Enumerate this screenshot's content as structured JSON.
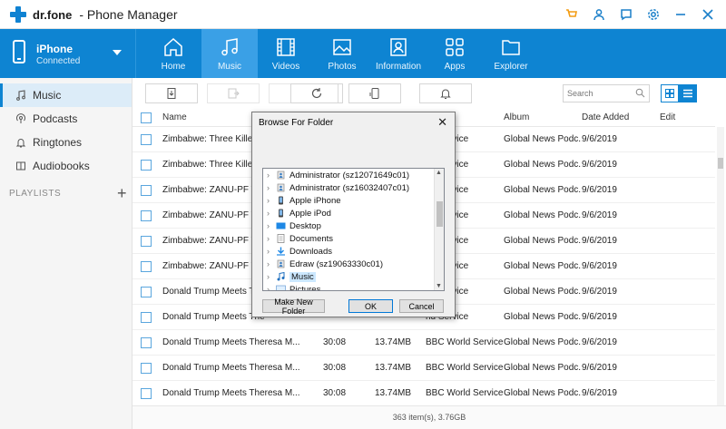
{
  "titlebar": {
    "logo_text": "dr.fone",
    "app_title": "- Phone Manager"
  },
  "device": {
    "name": "iPhone",
    "status": "Connected"
  },
  "nav": {
    "tabs": [
      {
        "label": "Home",
        "icon": "home-icon"
      },
      {
        "label": "Music",
        "icon": "music-icon"
      },
      {
        "label": "Videos",
        "icon": "film-icon"
      },
      {
        "label": "Photos",
        "icon": "photo-icon"
      },
      {
        "label": "Information",
        "icon": "contact-card-icon"
      },
      {
        "label": "Apps",
        "icon": "apps-grid-icon"
      },
      {
        "label": "Explorer",
        "icon": "folder-icon"
      }
    ],
    "active": "Music"
  },
  "sidebar": {
    "items": [
      {
        "label": "Music",
        "icon": "music-note-icon"
      },
      {
        "label": "Podcasts",
        "icon": "podcast-icon"
      },
      {
        "label": "Ringtones",
        "icon": "bell-icon"
      },
      {
        "label": "Audiobooks",
        "icon": "book-icon"
      }
    ],
    "playlists_label": "PLAYLISTS",
    "add_label": "+"
  },
  "toolbar": {
    "search_placeholder": "Search"
  },
  "table": {
    "headers": {
      "name": "Name",
      "album": "Album",
      "date_added": "Date Added",
      "edit": "Edit"
    },
    "rows": [
      {
        "name": "Zimbabwe: Three Killed a",
        "time": "",
        "size": "",
        "artist": "rld Service",
        "album": "Global News Podc...",
        "date": "9/6/2019"
      },
      {
        "name": "Zimbabwe: Three Killed a",
        "time": "",
        "size": "",
        "artist": "rld Service",
        "album": "Global News Podc...",
        "date": "9/6/2019"
      },
      {
        "name": "Zimbabwe: ZANU-PF Wins",
        "time": "",
        "size": "",
        "artist": "rld Service",
        "album": "Global News Podc...",
        "date": "9/6/2019"
      },
      {
        "name": "Zimbabwe: ZANU-PF Wins",
        "time": "",
        "size": "",
        "artist": "rld Service",
        "album": "Global News Podc...",
        "date": "9/6/2019"
      },
      {
        "name": "Zimbabwe: ZANU-PF Wins",
        "time": "",
        "size": "",
        "artist": "rld Service",
        "album": "Global News Podc...",
        "date": "9/6/2019"
      },
      {
        "name": "Zimbabwe: ZANU-PF Wins",
        "time": "",
        "size": "",
        "artist": "rld Service",
        "album": "Global News Podc...",
        "date": "9/6/2019"
      },
      {
        "name": "Donald Trump Meets The",
        "time": "",
        "size": "",
        "artist": "rld Service",
        "album": "Global News Podc...",
        "date": "9/6/2019"
      },
      {
        "name": "Donald Trump Meets The",
        "time": "",
        "size": "",
        "artist": "rld Service",
        "album": "Global News Podc...",
        "date": "9/6/2019"
      },
      {
        "name": "Donald Trump Meets Theresa M...",
        "time": "30:08",
        "size": "13.74MB",
        "artist": "BBC World Service",
        "album": "Global News Podc...",
        "date": "9/6/2019"
      },
      {
        "name": "Donald Trump Meets Theresa M...",
        "time": "30:08",
        "size": "13.74MB",
        "artist": "BBC World Service",
        "album": "Global News Podc...",
        "date": "9/6/2019"
      },
      {
        "name": "Donald Trump Meets Theresa M...",
        "time": "30:08",
        "size": "13.74MB",
        "artist": "BBC World Service",
        "album": "Global News Podc...",
        "date": "9/6/2019"
      }
    ]
  },
  "status": "363 item(s), 3.76GB",
  "dialog": {
    "title": "Browse For Folder",
    "tree": [
      {
        "label": "Administrator (sz12071649c01)",
        "icon": "user-folder-icon"
      },
      {
        "label": "Administrator (sz16032407c01)",
        "icon": "user-folder-icon"
      },
      {
        "label": "Apple iPhone",
        "icon": "phone-icon"
      },
      {
        "label": "Apple iPod",
        "icon": "phone-icon"
      },
      {
        "label": "Desktop",
        "icon": "desktop-folder-icon"
      },
      {
        "label": "Documents",
        "icon": "documents-icon"
      },
      {
        "label": "Downloads",
        "icon": "download-icon"
      },
      {
        "label": "Edraw (sz19063330c01)",
        "icon": "user-folder-icon"
      },
      {
        "label": "Music",
        "icon": "music-note-icon"
      },
      {
        "label": "Pictures",
        "icon": "pictures-icon"
      }
    ],
    "selected": "Music",
    "new_folder_label": "Make New Folder",
    "ok_label": "OK",
    "cancel_label": "Cancel"
  }
}
